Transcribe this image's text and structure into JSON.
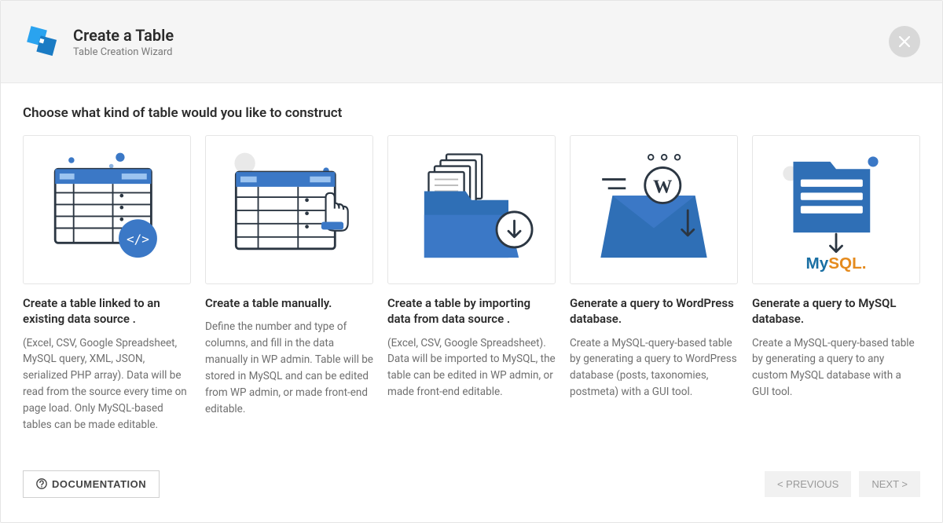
{
  "header": {
    "title": "Create a Table",
    "subtitle": "Table Creation Wizard"
  },
  "prompt": "Choose what kind of table would you like to construct",
  "cards": [
    {
      "title": "Create a table linked to an existing data source .",
      "desc": "(Excel, CSV, Google Spreadsheet, MySQL query, XML, JSON, serialized PHP array). Data will be read from the source every time on page load. Only MySQL-based tables can be made editable."
    },
    {
      "title": "Create a table manually.",
      "desc": "Define the number and type of columns, and fill in the data manually in WP admin. Table will be stored in MySQL and can be edited from WP admin, or made front-end editable."
    },
    {
      "title": "Create a table by importing data from data source .",
      "desc": "(Excel, CSV, Google Spreadsheet). Data will be imported to MySQL, the table can be edited in WP admin, or made front-end editable."
    },
    {
      "title": "Generate a query to WordPress database.",
      "desc": "Create a MySQL-query-based table by generating a query to WordPress database (posts, taxonomies, postmeta) with a GUI tool."
    },
    {
      "title": "Generate a query to MySQL database.",
      "desc": "Create a MySQL-query-based table by generating a query to any custom MySQL database with a GUI tool.",
      "logo": "MySQL."
    }
  ],
  "footer": {
    "documentation": "DOCUMENTATION",
    "previous": "< PREVIOUS",
    "next": "NEXT >"
  }
}
